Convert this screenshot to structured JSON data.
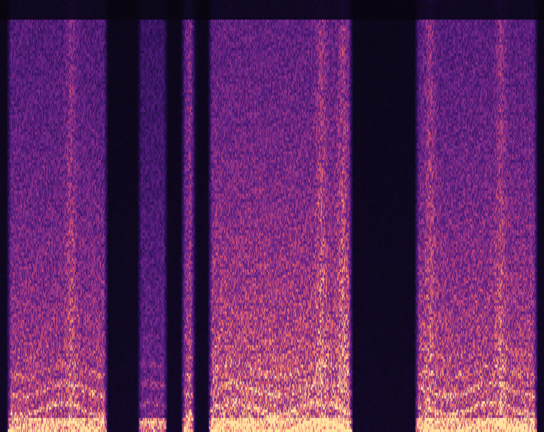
{
  "image": {
    "kind": "spectrogram",
    "colormap": "magma",
    "colors": {
      "background": "#08050f",
      "low": "#1a0b3a",
      "mid": "#6b2a9c",
      "high": "#d6457a",
      "peak": "#ffd08a"
    },
    "segments": [
      {
        "start": 0.01,
        "end": 0.2,
        "level": 0.75
      },
      {
        "start": 0.25,
        "end": 0.31,
        "level": 0.55
      },
      {
        "start": 0.33,
        "end": 0.36,
        "level": 0.7
      },
      {
        "start": 0.38,
        "end": 0.65,
        "level": 0.85
      },
      {
        "start": 0.76,
        "end": 0.99,
        "level": 0.8
      }
    ]
  }
}
